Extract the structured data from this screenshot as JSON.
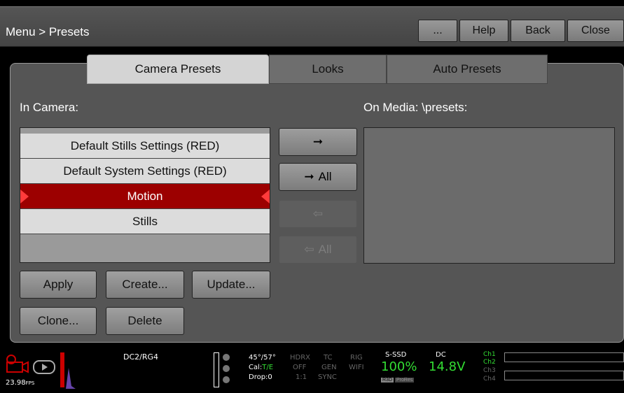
{
  "header": {
    "breadcrumb": "Menu > Presets",
    "buttons": [
      "...",
      "Help",
      "Back",
      "Close"
    ]
  },
  "tabs": [
    {
      "label": "Camera Presets",
      "active": true
    },
    {
      "label": "Looks",
      "active": false
    },
    {
      "label": "Auto Presets",
      "active": false
    }
  ],
  "in_camera": {
    "label": "In Camera:",
    "items": [
      {
        "label": "Default Stills Settings (RED)",
        "selected": false
      },
      {
        "label": "Default System Settings (RED)",
        "selected": false
      },
      {
        "label": "Motion",
        "selected": true
      },
      {
        "label": "Stills",
        "selected": false
      }
    ]
  },
  "on_media": {
    "label": "On Media: \\presets:"
  },
  "transfer": [
    {
      "arrow": "➞",
      "label": "",
      "enabled": true
    },
    {
      "arrow": "➞",
      "label": "All",
      "enabled": true
    },
    {
      "arrow": "⇦",
      "label": "",
      "enabled": false
    },
    {
      "arrow": "⇦",
      "label": "All",
      "enabled": false
    }
  ],
  "actions": {
    "apply": "Apply",
    "create": "Create...",
    "update": "Update...",
    "clone": "Clone...",
    "delete": "Delete"
  },
  "status_bar": {
    "fps": "23.98",
    "fps_unit": "FPS",
    "dc_rg": "DC2/RG4",
    "angle": "45°/57°",
    "cal_label": "Cal:",
    "cal_value": "T/E",
    "drop": "Drop:0",
    "hdrx": "HDRX",
    "off": "OFF",
    "ratio": "1:1",
    "tc": "TC",
    "gen": "GEN",
    "sync": "SYNC",
    "rig": "RIG",
    "wifi": "WIFI",
    "media_label": "S-SSD",
    "media_percent": "100%",
    "codec1": "R3D",
    "codec2": "ProRes",
    "power_label": "DC",
    "power_value": "14.8V",
    "channels": [
      "Ch1",
      "Ch2",
      "Ch3",
      "Ch4"
    ]
  },
  "colors": {
    "selected_row": "#9c0000",
    "selection_marker": "#ff3b3b",
    "status_green": "#33dd33",
    "record_red": "#cc0000"
  }
}
